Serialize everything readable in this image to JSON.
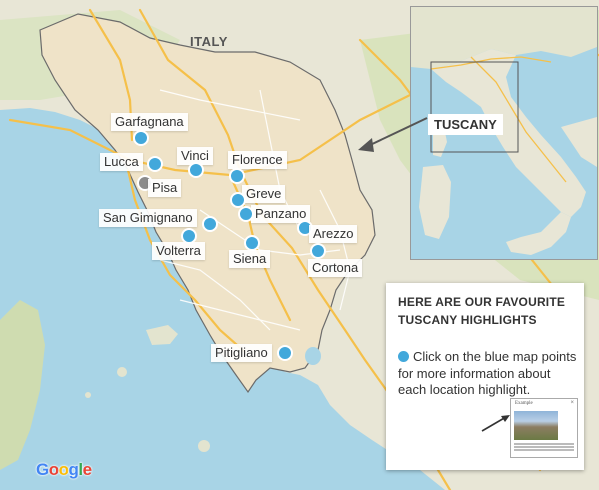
{
  "map": {
    "country_label": "ITALY",
    "inset_label": "TUSCANY",
    "attribution": "Google",
    "colors": {
      "water": "#a8d4e6",
      "land": "#e8e6d6",
      "land_green": "#c9dcab",
      "tuscany": "#efe3c8",
      "tuscany_border": "#6b6b6b",
      "road_major": "#f5c04a",
      "road_minor": "#ffffff",
      "point": "#42a8db",
      "point_grey": "#8b8b8b"
    }
  },
  "locations": [
    {
      "name": "Garfagnana",
      "color": "blue",
      "interactive": true
    },
    {
      "name": "Lucca",
      "color": "blue",
      "interactive": true
    },
    {
      "name": "Pisa",
      "color": "grey",
      "interactive": false
    },
    {
      "name": "Vinci",
      "color": "blue",
      "interactive": true
    },
    {
      "name": "Florence",
      "color": "blue",
      "interactive": true
    },
    {
      "name": "Greve",
      "color": "blue",
      "interactive": true
    },
    {
      "name": "Panzano",
      "color": "blue",
      "interactive": true
    },
    {
      "name": "San Gimignano",
      "color": "blue",
      "interactive": true
    },
    {
      "name": "Volterra",
      "color": "blue",
      "interactive": true
    },
    {
      "name": "Siena",
      "color": "blue",
      "interactive": true
    },
    {
      "name": "Arezzo",
      "color": "blue",
      "interactive": true
    },
    {
      "name": "Cortona",
      "color": "blue",
      "interactive": true
    },
    {
      "name": "Pitigliano",
      "color": "blue",
      "interactive": true
    }
  ],
  "panel": {
    "title_line1": "HERE ARE OUR FAVOURITE",
    "title_line2": "TUSCANY HIGHLIGHTS",
    "body": "Click on the blue map points for more information about each location highlight.",
    "thumbnail_title": "Example",
    "thumbnail_close": "×"
  }
}
